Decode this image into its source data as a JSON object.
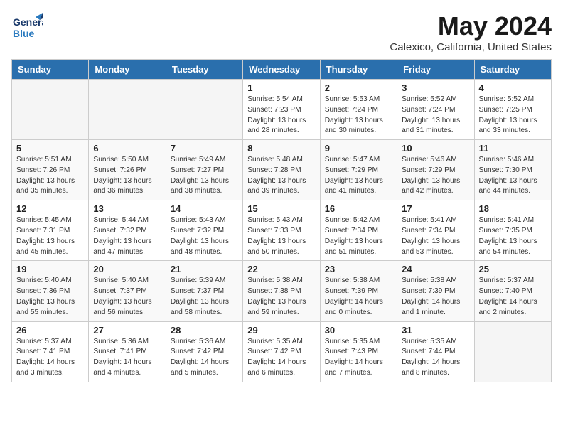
{
  "logo": {
    "line1": "General",
    "line2": "Blue"
  },
  "title": "May 2024",
  "location": "Calexico, California, United States",
  "headers": [
    "Sunday",
    "Monday",
    "Tuesday",
    "Wednesday",
    "Thursday",
    "Friday",
    "Saturday"
  ],
  "weeks": [
    [
      {
        "day": "",
        "details": ""
      },
      {
        "day": "",
        "details": ""
      },
      {
        "day": "",
        "details": ""
      },
      {
        "day": "1",
        "details": "Sunrise: 5:54 AM\nSunset: 7:23 PM\nDaylight: 13 hours\nand 28 minutes."
      },
      {
        "day": "2",
        "details": "Sunrise: 5:53 AM\nSunset: 7:24 PM\nDaylight: 13 hours\nand 30 minutes."
      },
      {
        "day": "3",
        "details": "Sunrise: 5:52 AM\nSunset: 7:24 PM\nDaylight: 13 hours\nand 31 minutes."
      },
      {
        "day": "4",
        "details": "Sunrise: 5:52 AM\nSunset: 7:25 PM\nDaylight: 13 hours\nand 33 minutes."
      }
    ],
    [
      {
        "day": "5",
        "details": "Sunrise: 5:51 AM\nSunset: 7:26 PM\nDaylight: 13 hours\nand 35 minutes."
      },
      {
        "day": "6",
        "details": "Sunrise: 5:50 AM\nSunset: 7:26 PM\nDaylight: 13 hours\nand 36 minutes."
      },
      {
        "day": "7",
        "details": "Sunrise: 5:49 AM\nSunset: 7:27 PM\nDaylight: 13 hours\nand 38 minutes."
      },
      {
        "day": "8",
        "details": "Sunrise: 5:48 AM\nSunset: 7:28 PM\nDaylight: 13 hours\nand 39 minutes."
      },
      {
        "day": "9",
        "details": "Sunrise: 5:47 AM\nSunset: 7:29 PM\nDaylight: 13 hours\nand 41 minutes."
      },
      {
        "day": "10",
        "details": "Sunrise: 5:46 AM\nSunset: 7:29 PM\nDaylight: 13 hours\nand 42 minutes."
      },
      {
        "day": "11",
        "details": "Sunrise: 5:46 AM\nSunset: 7:30 PM\nDaylight: 13 hours\nand 44 minutes."
      }
    ],
    [
      {
        "day": "12",
        "details": "Sunrise: 5:45 AM\nSunset: 7:31 PM\nDaylight: 13 hours\nand 45 minutes."
      },
      {
        "day": "13",
        "details": "Sunrise: 5:44 AM\nSunset: 7:32 PM\nDaylight: 13 hours\nand 47 minutes."
      },
      {
        "day": "14",
        "details": "Sunrise: 5:43 AM\nSunset: 7:32 PM\nDaylight: 13 hours\nand 48 minutes."
      },
      {
        "day": "15",
        "details": "Sunrise: 5:43 AM\nSunset: 7:33 PM\nDaylight: 13 hours\nand 50 minutes."
      },
      {
        "day": "16",
        "details": "Sunrise: 5:42 AM\nSunset: 7:34 PM\nDaylight: 13 hours\nand 51 minutes."
      },
      {
        "day": "17",
        "details": "Sunrise: 5:41 AM\nSunset: 7:34 PM\nDaylight: 13 hours\nand 53 minutes."
      },
      {
        "day": "18",
        "details": "Sunrise: 5:41 AM\nSunset: 7:35 PM\nDaylight: 13 hours\nand 54 minutes."
      }
    ],
    [
      {
        "day": "19",
        "details": "Sunrise: 5:40 AM\nSunset: 7:36 PM\nDaylight: 13 hours\nand 55 minutes."
      },
      {
        "day": "20",
        "details": "Sunrise: 5:40 AM\nSunset: 7:37 PM\nDaylight: 13 hours\nand 56 minutes."
      },
      {
        "day": "21",
        "details": "Sunrise: 5:39 AM\nSunset: 7:37 PM\nDaylight: 13 hours\nand 58 minutes."
      },
      {
        "day": "22",
        "details": "Sunrise: 5:38 AM\nSunset: 7:38 PM\nDaylight: 13 hours\nand 59 minutes."
      },
      {
        "day": "23",
        "details": "Sunrise: 5:38 AM\nSunset: 7:39 PM\nDaylight: 14 hours\nand 0 minutes."
      },
      {
        "day": "24",
        "details": "Sunrise: 5:38 AM\nSunset: 7:39 PM\nDaylight: 14 hours\nand 1 minute."
      },
      {
        "day": "25",
        "details": "Sunrise: 5:37 AM\nSunset: 7:40 PM\nDaylight: 14 hours\nand 2 minutes."
      }
    ],
    [
      {
        "day": "26",
        "details": "Sunrise: 5:37 AM\nSunset: 7:41 PM\nDaylight: 14 hours\nand 3 minutes."
      },
      {
        "day": "27",
        "details": "Sunrise: 5:36 AM\nSunset: 7:41 PM\nDaylight: 14 hours\nand 4 minutes."
      },
      {
        "day": "28",
        "details": "Sunrise: 5:36 AM\nSunset: 7:42 PM\nDaylight: 14 hours\nand 5 minutes."
      },
      {
        "day": "29",
        "details": "Sunrise: 5:35 AM\nSunset: 7:42 PM\nDaylight: 14 hours\nand 6 minutes."
      },
      {
        "day": "30",
        "details": "Sunrise: 5:35 AM\nSunset: 7:43 PM\nDaylight: 14 hours\nand 7 minutes."
      },
      {
        "day": "31",
        "details": "Sunrise: 5:35 AM\nSunset: 7:44 PM\nDaylight: 14 hours\nand 8 minutes."
      },
      {
        "day": "",
        "details": ""
      }
    ]
  ]
}
